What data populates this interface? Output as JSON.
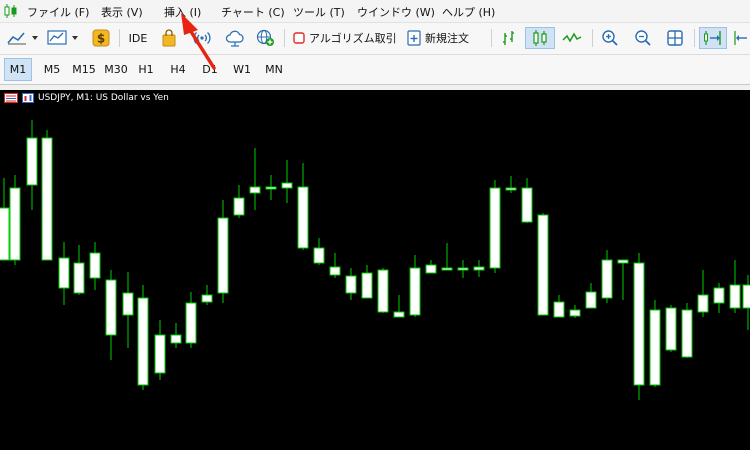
{
  "menu": [
    "ファイル (F)",
    "表示 (V)",
    "挿入 (I)",
    "チャート (C)",
    "ツール (T)",
    "ウインドウ (W)",
    "ヘルプ (H)"
  ],
  "toolbar": {
    "ide_label": "IDE",
    "algo_label": "アルゴリズム取引",
    "new_order_label": "新規注文"
  },
  "timeframes": [
    "M1",
    "M5",
    "M15",
    "M30",
    "H1",
    "H4",
    "D1",
    "W1",
    "MN"
  ],
  "active_timeframe": "M1",
  "chart": {
    "title": "USDJPY, M1:  US Dollar vs Yen",
    "background": "#000000",
    "bull_color": "#ffffff",
    "wick_color": "#00cc00"
  },
  "annotation": {
    "arrow_color": "#e82410",
    "points_to": "挿入 (I)"
  }
}
